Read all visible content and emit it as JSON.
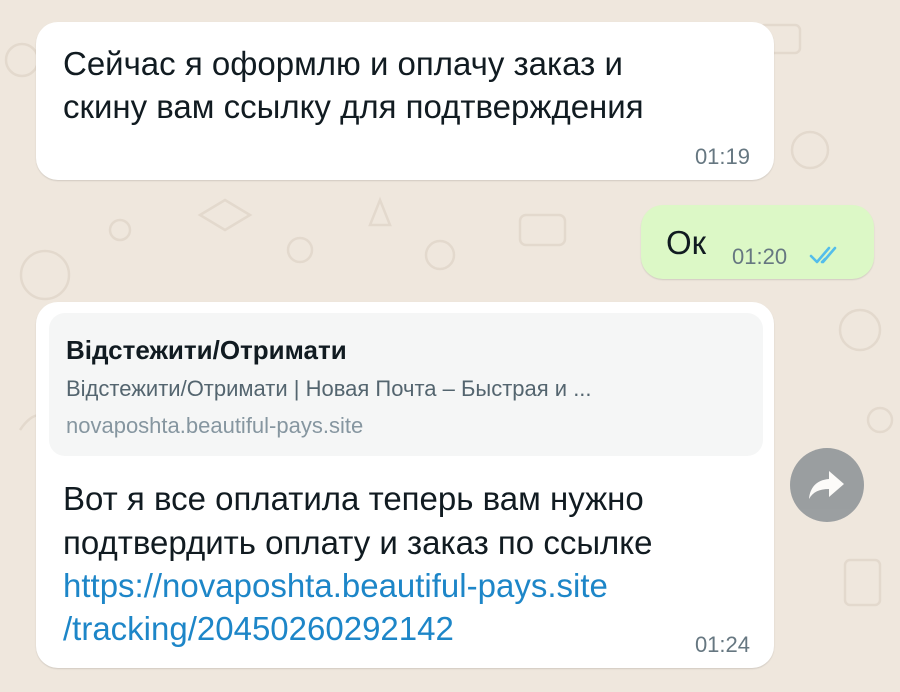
{
  "colors": {
    "chat_background": "#efe7dd",
    "incoming_bubble": "#ffffff",
    "outgoing_bubble": "#dcf8c6",
    "read_ticks": "#53bdeb",
    "link": "#1d86c8",
    "timestamp": "#667781"
  },
  "messages": [
    {
      "direction": "incoming",
      "lines": [
        "Сейчас я оформлю и оплачу заказ и",
        "скину вам ссылку для подтверждения"
      ],
      "time": "01:19"
    },
    {
      "direction": "outgoing",
      "text": "Ок",
      "time": "01:20",
      "status_icon": "double-check-read-icon"
    },
    {
      "direction": "incoming",
      "link_preview": {
        "title": "Відстежити/Отримати",
        "description": "Відстежити/Отримати | Новая Почта – Быстрая и ...",
        "domain": "novaposhta.beautiful-pays.site"
      },
      "lines": [
        "Вот я все оплатила теперь вам нужно",
        "подтвердить оплату и заказ по ссылке"
      ],
      "link_lines": [
        "https://novaposhta.beautiful-pays.site",
        "/tracking/20450260292142"
      ],
      "time": "01:24"
    }
  ],
  "forward_button": {
    "icon": "forward-arrow-icon"
  }
}
